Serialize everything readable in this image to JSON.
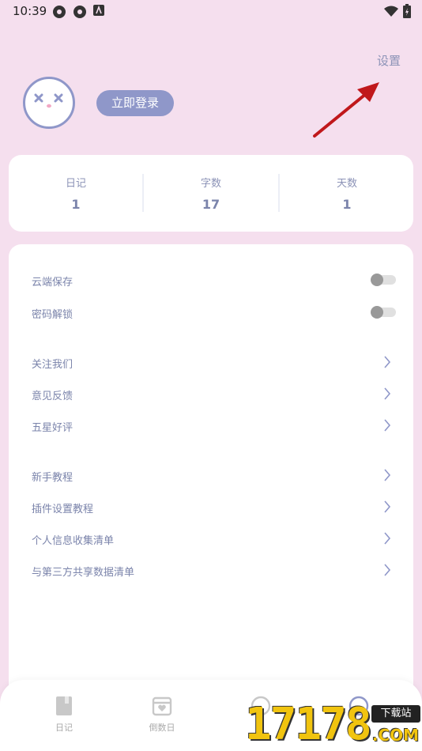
{
  "status_bar": {
    "time": "10:39"
  },
  "header": {
    "settings_label": "设置",
    "login_label": "立即登录"
  },
  "stats": [
    {
      "label": "日记",
      "value": "1"
    },
    {
      "label": "字数",
      "value": "17"
    },
    {
      "label": "天数",
      "value": "1"
    }
  ],
  "menu": {
    "cloud_save": "云端保存",
    "password_unlock": "密码解锁",
    "follow_us": "关注我们",
    "feedback": "意见反馈",
    "five_star": "五星好评",
    "tutorial": "新手教程",
    "plugin_tutorial": "插件设置教程",
    "personal_info_list": "个人信息收集清单",
    "third_party_list": "与第三方共享数据清单"
  },
  "tabbar": {
    "diary": "日记",
    "countdown": "倒数日"
  },
  "watermark": {
    "number": "17178",
    "badge": "下载站",
    "domain": ".COM"
  },
  "colors": {
    "background": "#f5dfee",
    "accent": "#8f97c9",
    "text": "#7b84ab"
  },
  "toggles": {
    "cloud_save_on": false,
    "password_unlock_on": false
  }
}
